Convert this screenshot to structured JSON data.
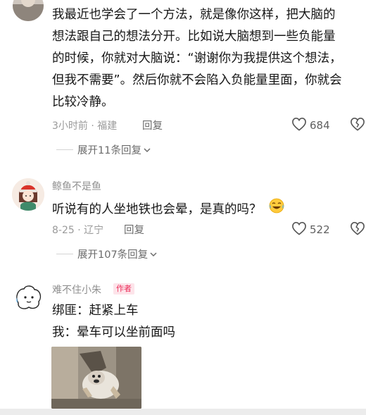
{
  "comment1": {
    "text_lines": [
      "我最近也学会了一个方法，就是像你这样，把大脑的",
      "想法跟自己的想法分开。比如说大脑想到一些负能量",
      "的时候，你就对大脑说：“谢谢你为我提供这个想法，",
      "但我不需要”。然后你就不会陷入负能量里面，你就会",
      "比较冷静。"
    ],
    "time_location": "3小时前 · 福建",
    "reply_label": "回复",
    "likes": "684",
    "expand_label": "展开11条回复"
  },
  "comment2": {
    "username": "鲸鱼不是鱼",
    "text": "听说有的人坐地铁也会晕，是真的吗？",
    "time_location": "8-25 · 辽宁",
    "reply_label": "回复",
    "likes": "522",
    "expand_label": "展开107条回复"
  },
  "comment3": {
    "username": "难不住小朱",
    "badge": "作者",
    "line1": "绑匪：赶紧上车",
    "line2": "我：晕车可以坐前面吗"
  },
  "icons": {
    "heart": "heart-outline-icon",
    "dislike": "broken-heart-icon",
    "chevron": "chevron-down-icon",
    "emoji": "crying-laughing-emoji"
  },
  "colors": {
    "author_badge_bg": "#fde4ea",
    "author_badge_text": "#ec2d5a"
  }
}
